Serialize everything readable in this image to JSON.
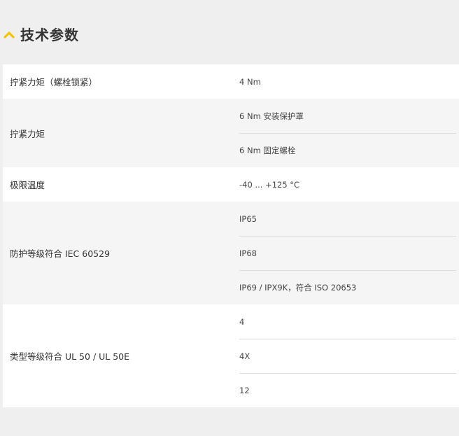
{
  "section": {
    "title": "技术参数",
    "icon": "chevron-up-icon",
    "accent_color": "#f5c400"
  },
  "specs": [
    {
      "label": "拧紧力矩（螺栓锁紧）",
      "values": [
        " 4 Nm"
      ]
    },
    {
      "label": "拧紧力矩",
      "values": [
        "6 Nm 安装保护罩",
        "6 Nm 固定螺栓"
      ]
    },
    {
      "label": "极限温度",
      "values": [
        "-40 ... +125 °C"
      ]
    },
    {
      "label": "防护等级符合 IEC 60529",
      "values": [
        "IP65",
        "IP68",
        "IP69 / IPX9K，符合 ISO 20653"
      ]
    },
    {
      "label": "类型等级符合 UL 50 / UL 50E",
      "values": [
        "4",
        "4X",
        "12"
      ]
    }
  ]
}
